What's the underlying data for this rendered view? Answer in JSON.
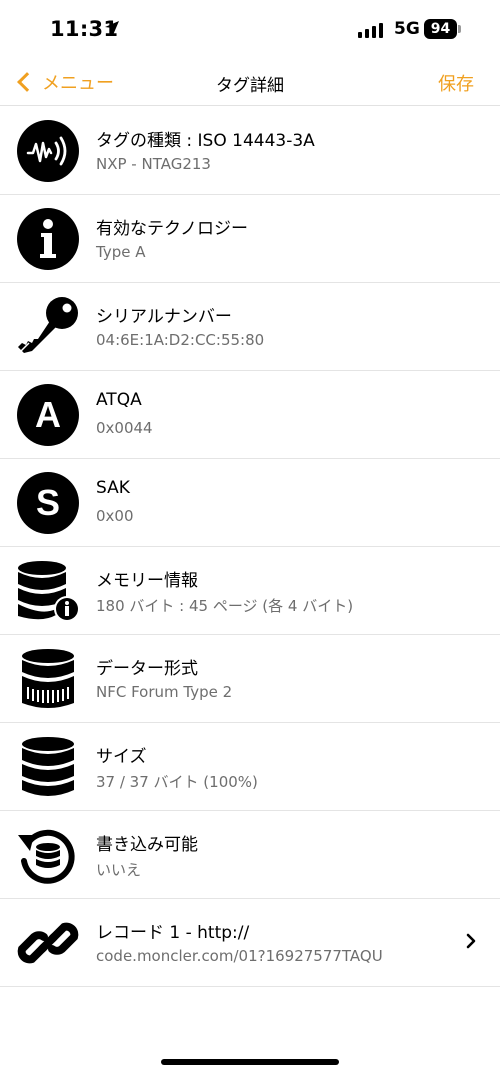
{
  "status_bar": {
    "time": "11:31",
    "network": "5G",
    "battery": "94"
  },
  "nav": {
    "back_label": "メニュー",
    "title": "タグ詳細",
    "save_label": "保存"
  },
  "rows": [
    {
      "icon": "nfc-tag-icon",
      "title": "タグの種類 : ISO 14443-3A",
      "subtitle": "NXP - NTAG213"
    },
    {
      "icon": "info-icon",
      "title": "有効なテクノロジー",
      "subtitle": "Type A"
    },
    {
      "icon": "key-icon",
      "title": "シリアルナンバー",
      "subtitle": "04:6E:1A:D2:CC:55:80"
    },
    {
      "icon": "letter-a-icon",
      "title": "ATQA",
      "subtitle": "0x0044"
    },
    {
      "icon": "letter-s-icon",
      "title": "SAK",
      "subtitle": "0x00"
    },
    {
      "icon": "database-info-icon",
      "title": "メモリー情報",
      "subtitle": "180 バイト : 45 ページ (各 4 バイト)"
    },
    {
      "icon": "database-format-icon",
      "title": "データー形式",
      "subtitle": "NFC Forum Type 2"
    },
    {
      "icon": "database-icon",
      "title": "サイズ",
      "subtitle": "37 / 37 バイト (100%)"
    },
    {
      "icon": "database-rewrite-icon",
      "title": "書き込み可能",
      "subtitle": "いいえ"
    },
    {
      "icon": "link-icon",
      "title": "レコード 1 - http://",
      "subtitle": "code.moncler.com/01?16927577TAQU"
    }
  ],
  "colors": {
    "accent": "#f0a020",
    "subtitle": "#6e6e6e",
    "separator": "#e4e4e4"
  }
}
